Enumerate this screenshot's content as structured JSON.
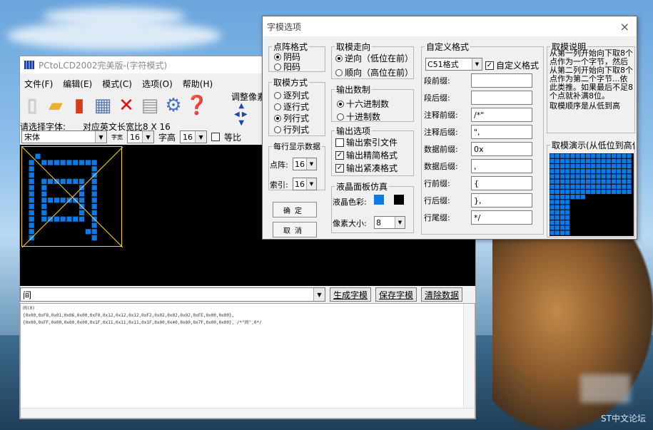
{
  "colors": {
    "pixel_on": "#0a7be8",
    "lcd_bg": "#000000",
    "char_box": "#ffd800"
  },
  "main_window": {
    "title": "PCtoLCD2002完美版-(字符模式)",
    "menu": [
      "文件(F)",
      "编辑(E)",
      "模式(C)",
      "选项(O)",
      "帮助(H)"
    ],
    "toolbar_icons": [
      "new-file-icon",
      "open-folder-icon",
      "save-icon",
      "export-icon",
      "delete-icon",
      "notes-icon",
      "settings-gear-icon",
      "help-icon"
    ],
    "adjust_label": "调整像素",
    "font_label": "请选择字体:",
    "font_size_label": "对应英文长宽比8 X 16",
    "font_name": "宋体",
    "char_width_label": "字宽",
    "char_width": "16",
    "char_height_label": "字高",
    "char_height": "16",
    "proportional_label": "等比",
    "input_text": "间",
    "buttons": {
      "generate": "生成字模",
      "save": "保存字模",
      "clear": "清除数据"
    },
    "output_lines": [
      "间(0)",
      "{0x00,0xF8,0x01,0x06,0x00,0xF0,0x12,0x12,0x12,0xF2,0x02,0x02,0x02,0xFE,0x00,0x00},",
      "{0x00,0xFF,0x00,0x00,0x00,0x1F,0x11,0x11,0x11,0x1F,0x00,0x40,0x80,0x7F,0x00,0x00}, /*\"间\",0*/"
    ],
    "glyph_rows": [
      "0000000000000000",
      "0010000000000000",
      "0101111111110000",
      "0100000000010000",
      "0100000000010000",
      "0101111111010000",
      "0101000001010000",
      "0101000001010000",
      "0101111111010000",
      "0101000001010000",
      "0101000001010000",
      "0101111111010000",
      "0100000000010000",
      "0100000000110000",
      "0100000000010000",
      "0000000000000000"
    ]
  },
  "dialog": {
    "title": "字模选项",
    "close": "×",
    "dot_format": {
      "legend": "点阵格式",
      "options": [
        "阴码",
        "阳码"
      ],
      "selected": 0
    },
    "scan_method": {
      "legend": "取模方式",
      "options": [
        "逐列式",
        "逐行式",
        "列行式",
        "行列式"
      ],
      "selected": 2
    },
    "per_line": {
      "legend": "每行显示数据",
      "dot_label": "点阵:",
      "dot_value": "16",
      "index_label": "索引:",
      "index_value": "16"
    },
    "confirm_button": "确定",
    "cancel_button": "取消",
    "direction": {
      "legend": "取模走向",
      "options": [
        "逆向（低位在前）",
        "顺向（高位在前）"
      ],
      "selected": 0
    },
    "number_system": {
      "legend": "输出数制",
      "options": [
        "十六进制数",
        "十进制数"
      ],
      "selected": 0
    },
    "output_options": {
      "legend": "输出选项",
      "items": [
        {
          "label": "输出索引文件",
          "checked": false
        },
        {
          "label": "输出精简格式",
          "checked": true
        },
        {
          "label": "输出紧凑格式",
          "checked": true
        }
      ]
    },
    "lcd_sim": {
      "legend": "液晶面板仿真",
      "color_label": "液晶色彩:",
      "pixel_size_label": "像素大小:",
      "pixel_size": "8"
    },
    "custom_format": {
      "legend": "自定义格式",
      "format_value": "C51格式",
      "custom_check_label": "自定义格式",
      "fields": [
        {
          "label": "段前缀:",
          "value": ""
        },
        {
          "label": "段后缀:",
          "value": ""
        },
        {
          "label": "注释前缀:",
          "value": "/*\""
        },
        {
          "label": "注释后缀:",
          "value": "\","
        },
        {
          "label": "数据前缀:",
          "value": "0x"
        },
        {
          "label": "数据后缀:",
          "value": ","
        },
        {
          "label": "行前缀:",
          "value": "{"
        },
        {
          "label": "行后缀:",
          "value": "},"
        },
        {
          "label": "行尾缀:",
          "value": "*/"
        }
      ]
    },
    "description": {
      "legend": "取模说明",
      "text": "从第一列开始向下取8个点作为一个字节，然后从第二列开始向下取8个点作为第二个字节...依此类推。如果最后不足8个点就补满8位。",
      "order": "取模顺序是从低到高"
    },
    "demo": {
      "legend": "取模演示(从低位到高位)"
    }
  },
  "watermark": "ST中文论坛"
}
